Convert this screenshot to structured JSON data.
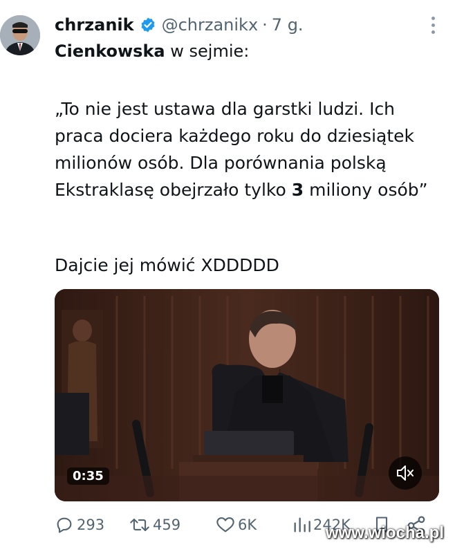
{
  "tweet": {
    "author_name": "chrzanik",
    "handle": "@chrzanikx",
    "separator": "·",
    "time": "7 g.",
    "title_bold": "Cienkowska",
    "title_rest": " w sejmie:",
    "quote_part1": "„To nie jest ustawa dla garstki ludzi. Ich praca dociera każdego roku do dziesiątek milionów osób. Dla porównania polską Ekstraklasę obejrzało tylko ",
    "quote_bold": "3",
    "quote_part2": " miliony osób”",
    "comment": "Dajcie jej mówić XDDDDD"
  },
  "video": {
    "duration": "0:35",
    "mute_icon": "speaker-muted-icon"
  },
  "actions": {
    "replies": "293",
    "retweets": "459",
    "likes": "6K",
    "views": "242K"
  },
  "watermark": "www.wiocha.pl",
  "colors": {
    "text": "#0f1419",
    "muted": "#536471",
    "verified": "#1d9bf0",
    "video_bg": "#3b2119"
  }
}
